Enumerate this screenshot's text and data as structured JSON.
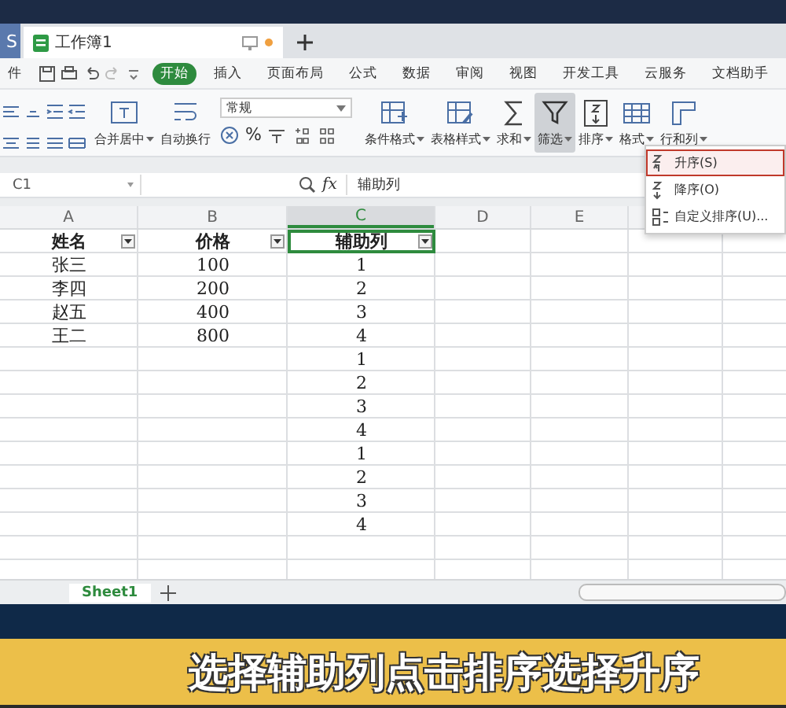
{
  "window_tabs": [
    {
      "kind": "app",
      "label": "S",
      "selected": false
    },
    {
      "kind": "doc",
      "label": "工作簿1",
      "selected": true
    }
  ],
  "menu": [
    {
      "label": "件",
      "selected": false
    },
    {
      "label": "开始",
      "selected": true
    },
    {
      "label": "插入",
      "selected": false
    },
    {
      "label": "页面布局",
      "selected": false
    },
    {
      "label": "公式",
      "selected": false
    },
    {
      "label": "数据",
      "selected": false
    },
    {
      "label": "审阅",
      "selected": false
    },
    {
      "label": "视图",
      "selected": false
    },
    {
      "label": "开发工具",
      "selected": false
    },
    {
      "label": "云服务",
      "selected": false
    },
    {
      "label": "文档助手",
      "selected": false
    }
  ],
  "ribbon": {
    "buttons": [
      {
        "kind": "merge",
        "label": "合并居中",
        "dropdown": true,
        "selected": false
      },
      {
        "kind": "wrap",
        "label": "自动换行",
        "dropdown": false,
        "selected": false
      },
      {
        "kind": "number",
        "number_format": "常规",
        "percent": "%"
      },
      {
        "kind": "conditional",
        "label": "条件格式",
        "dropdown": true,
        "selected": false
      },
      {
        "kind": "table",
        "label": "表格样式",
        "dropdown": true,
        "selected": false
      },
      {
        "kind": "sum",
        "label": "求和",
        "dropdown": true,
        "selected": false
      },
      {
        "kind": "filter",
        "label": "筛选",
        "dropdown": true,
        "selected": true
      },
      {
        "kind": "sort",
        "label": "排序",
        "dropdown": true,
        "selected": false
      },
      {
        "kind": "format",
        "label": "格式",
        "dropdown": true,
        "selected": false
      },
      {
        "kind": "rowcol",
        "label": "行和列",
        "dropdown": true,
        "selected": false
      }
    ]
  },
  "sort_menu": [
    {
      "label": "升序(S)",
      "selected": true
    },
    {
      "label": "降序(O)",
      "selected": false
    },
    {
      "label": "自定义排序(U)...",
      "selected": false
    }
  ],
  "formula_bar": {
    "cell_ref": "C1",
    "fx": "fx",
    "formula": "辅助列"
  },
  "columns": [
    {
      "label": "A",
      "selected": false
    },
    {
      "label": "B",
      "selected": false
    },
    {
      "label": "C",
      "selected": true
    },
    {
      "label": "D",
      "selected": false
    },
    {
      "label": "E",
      "selected": false
    }
  ],
  "header_row": [
    {
      "text": "姓名",
      "selected": false
    },
    {
      "text": "价格",
      "selected": false
    },
    {
      "text": "辅助列",
      "selected": true
    }
  ],
  "rows": [
    [
      "张三",
      "100",
      "1"
    ],
    [
      "李四",
      "200",
      "2"
    ],
    [
      "赵五",
      "400",
      "3"
    ],
    [
      "王二",
      "800",
      "4"
    ],
    [
      "",
      "",
      "1"
    ],
    [
      "",
      "",
      "2"
    ],
    [
      "",
      "",
      "3"
    ],
    [
      "",
      "",
      "4"
    ],
    [
      "",
      "",
      "1"
    ],
    [
      "",
      "",
      "2"
    ],
    [
      "",
      "",
      "3"
    ],
    [
      "",
      "",
      "4"
    ]
  ],
  "sheet_tabs": [
    {
      "label": "Sheet1",
      "selected": true
    }
  ],
  "subtitle": "选择辅助列点击排序选择升序"
}
